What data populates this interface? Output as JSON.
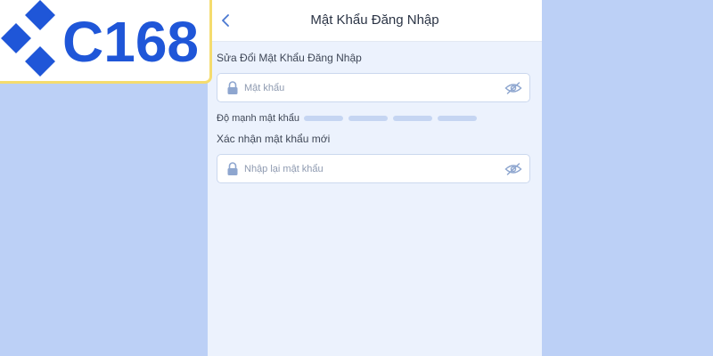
{
  "logo": {
    "text": "C168",
    "color": "#1f56d8"
  },
  "header": {
    "title": "Mật Khẩu Đăng Nhập",
    "back_icon": "chevron-left-icon"
  },
  "form": {
    "section_title": "Sửa Đổi Mật Khẩu Đăng Nhập",
    "password": {
      "placeholder": "Mật khẩu",
      "value": ""
    },
    "strength": {
      "label": "Độ mạnh mật khẩu",
      "level": 0,
      "segments": 4
    },
    "confirm_title": "Xác nhận mật khẩu mới",
    "confirm": {
      "placeholder": "Nhập lại mật khẩu",
      "value": ""
    }
  },
  "colors": {
    "background": "#bcd0f6",
    "panel": "#ecf2fd",
    "accent": "#1f56d8",
    "icon": "#8ea6cf",
    "strength_empty": "#c5d5f2"
  }
}
